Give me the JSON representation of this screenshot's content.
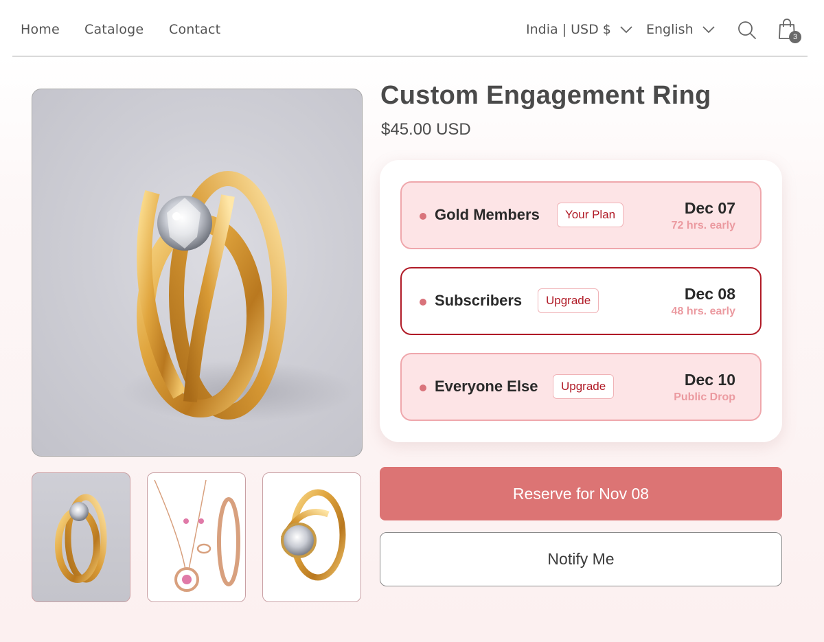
{
  "nav": {
    "links": [
      "Home",
      "Cataloge",
      "Contact"
    ],
    "country_currency": "India | USD $",
    "language": "English",
    "cart_count": "3"
  },
  "icons": {
    "search": "search-icon",
    "cart": "shopping-bag-icon",
    "chevron": "chevron-down-icon"
  },
  "product": {
    "title": "Custom Engagement Ring",
    "price": "$45.00 USD"
  },
  "tiers": [
    {
      "name": "Gold Members",
      "badge": "Your Plan",
      "date": "Dec 07",
      "note": "72 hrs. early",
      "selected": false
    },
    {
      "name": "Subscribers",
      "badge": "Upgrade",
      "date": "Dec 08",
      "note": "48 hrs. early",
      "selected": true
    },
    {
      "name": "Everyone Else",
      "badge": "Upgrade",
      "date": "Dec 10",
      "note": "Public Drop",
      "selected": false
    }
  ],
  "actions": {
    "reserve": "Reserve for Nov 08",
    "notify": "Notify Me"
  },
  "colors": {
    "accent": "#dc7474",
    "brand_red": "#b01a26",
    "tier_bg": "#fde4e6",
    "tier_border": "#efa7ac"
  }
}
